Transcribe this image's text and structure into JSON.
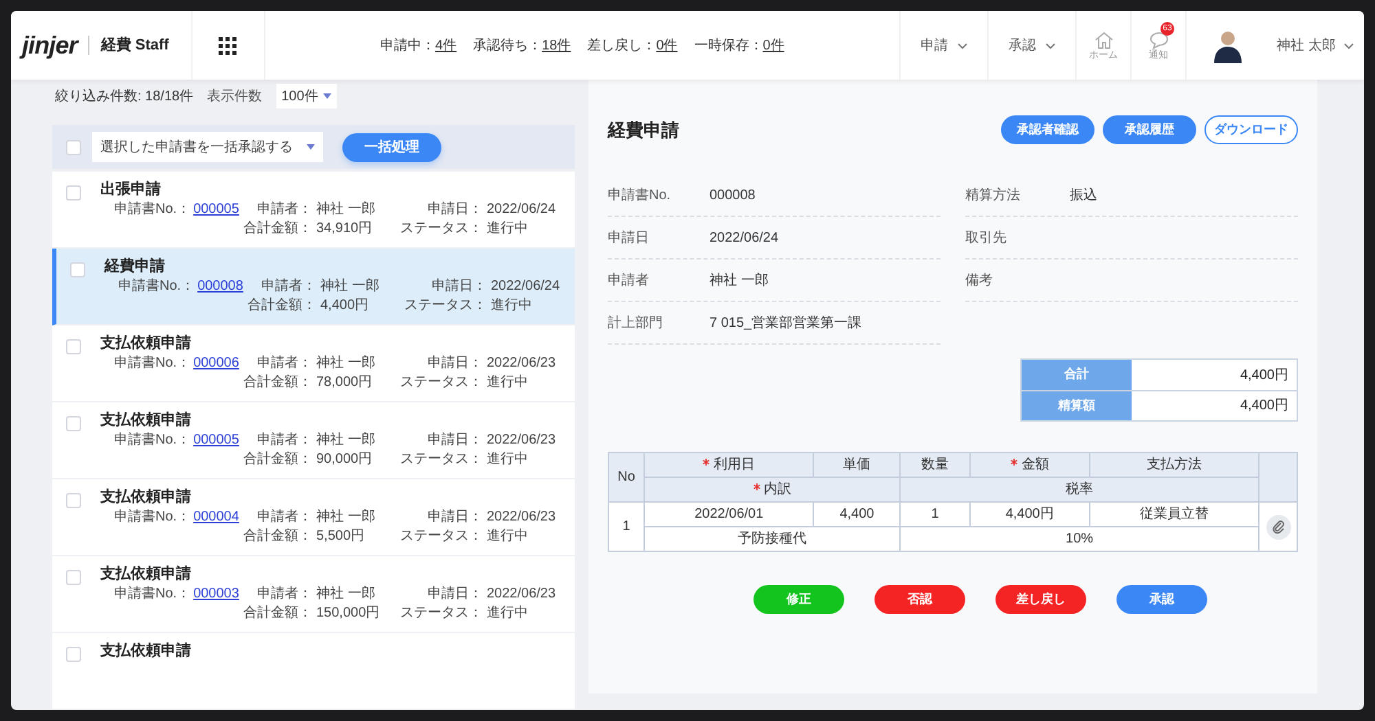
{
  "header": {
    "logo": "jinjer",
    "app_name": "経費 Staff",
    "counts": [
      {
        "label": "申請中：",
        "value": "4件"
      },
      {
        "label": "承認待ち：",
        "value": "18件"
      },
      {
        "label": "差し戻し：",
        "value": "0件"
      },
      {
        "label": "一時保存：",
        "value": "0件"
      }
    ],
    "menus": [
      "申請",
      "承認"
    ],
    "home_label": "ホーム",
    "notifications": {
      "label": "通知",
      "badge": "63"
    },
    "user": "神社 太郎"
  },
  "filter": {
    "count_text": "絞り込み件数: 18/18件",
    "per_page_label": "表示件数",
    "per_page": "100件"
  },
  "bulk": {
    "select_all_checked": false,
    "action": "選択した申請書を一括承認する",
    "button": "一括処理"
  },
  "list": [
    {
      "title": "出張申請",
      "no_label": "申請書No.：",
      "no": "000005",
      "applicant_label": "申請者：",
      "applicant": "神社 一郎",
      "date_label": "申請日：",
      "date": "2022/06/24",
      "total_label": "合計金額：",
      "total": "34,910円",
      "status_label": "ステータス：",
      "status": "進行中",
      "selected": false,
      "checked": false
    },
    {
      "title": "経費申請",
      "no_label": "申請書No.：",
      "no": "000008",
      "applicant_label": "申請者：",
      "applicant": "神社 一郎",
      "date_label": "申請日：",
      "date": "2022/06/24",
      "total_label": "合計金額：",
      "total": "4,400円",
      "status_label": "ステータス：",
      "status": "進行中",
      "selected": true,
      "checked": false
    },
    {
      "title": "支払依頼申請",
      "no_label": "申請書No.：",
      "no": "000006",
      "applicant_label": "申請者：",
      "applicant": "神社 一郎",
      "date_label": "申請日：",
      "date": "2022/06/23",
      "total_label": "合計金額：",
      "total": "78,000円",
      "status_label": "ステータス：",
      "status": "進行中",
      "selected": false,
      "checked": false
    },
    {
      "title": "支払依頼申請",
      "no_label": "申請書No.：",
      "no": "000005",
      "applicant_label": "申請者：",
      "applicant": "神社 一郎",
      "date_label": "申請日：",
      "date": "2022/06/23",
      "total_label": "合計金額：",
      "total": "90,000円",
      "status_label": "ステータス：",
      "status": "進行中",
      "selected": false,
      "checked": false
    },
    {
      "title": "支払依頼申請",
      "no_label": "申請書No.：",
      "no": "000004",
      "applicant_label": "申請者：",
      "applicant": "神社 一郎",
      "date_label": "申請日：",
      "date": "2022/06/23",
      "total_label": "合計金額：",
      "total": "5,500円",
      "status_label": "ステータス：",
      "status": "進行中",
      "selected": false,
      "checked": false
    },
    {
      "title": "支払依頼申請",
      "no_label": "申請書No.：",
      "no": "000003",
      "applicant_label": "申請者：",
      "applicant": "神社 一郎",
      "date_label": "申請日：",
      "date": "2022/06/23",
      "total_label": "合計金額：",
      "total": "150,000円",
      "status_label": "ステータス：",
      "status": "進行中",
      "selected": false,
      "checked": false
    },
    {
      "title": "支払依頼申請",
      "selected": false,
      "checked": false
    }
  ],
  "detail": {
    "title": "経費申請",
    "buttons": [
      {
        "label": "承認者確認",
        "kind": "primary"
      },
      {
        "label": "承認履歴",
        "kind": "primary"
      },
      {
        "label": "ダウンロード",
        "kind": "outline"
      }
    ],
    "fields_left": [
      {
        "label": "申請書No.",
        "value": "000008"
      },
      {
        "label": "申請日",
        "value": "2022/06/24"
      },
      {
        "label": "申請者",
        "value": "神社 一郎"
      },
      {
        "label": "計上部門",
        "value": "7 015_営業部営業第一課"
      }
    ],
    "fields_right": [
      {
        "label": "精算方法",
        "value": "振込"
      },
      {
        "label": "取引先"
      },
      {
        "label": "備考"
      }
    ],
    "totals": [
      {
        "label": "合計",
        "value": "4,400円"
      },
      {
        "label": "精算額",
        "value": "4,400円"
      }
    ],
    "table": {
      "no_header": "No",
      "header_row_1": [
        {
          "label": "利用日",
          "required": true
        },
        {
          "label": "単価",
          "required": false
        },
        {
          "label": "数量",
          "required": false
        },
        {
          "label": "金額",
          "required": true
        },
        {
          "label": "支払方法",
          "required": false
        }
      ],
      "header_row_2": [
        {
          "label": "内訳",
          "required": true
        },
        {
          "label": "税率",
          "required": false
        }
      ],
      "rows": [
        {
          "no": "1",
          "cells_1": [
            "2022/06/01",
            "4,400",
            "1",
            "4,400円",
            "従業員立替"
          ],
          "cells_2": [
            "予防接種代",
            "10%"
          ]
        }
      ]
    },
    "actions": [
      {
        "label": "修正",
        "color": "#14c41e"
      },
      {
        "label": "否認",
        "color": "#f42424"
      },
      {
        "label": "差し戻し",
        "color": "#f42424"
      },
      {
        "label": "承認",
        "color": "#3a87f5"
      }
    ]
  }
}
